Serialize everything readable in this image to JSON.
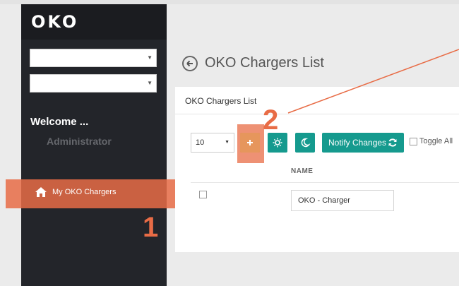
{
  "app": {
    "logo": "OKO"
  },
  "sidebar": {
    "select_1": "",
    "select_2": "",
    "welcome": "Welcome ...",
    "role": "Administrator",
    "menu": [
      {
        "label": "My OKO Chargers",
        "icon": "home-icon"
      }
    ]
  },
  "page": {
    "title": "OKO Chargers List"
  },
  "panel": {
    "title": "OKO Chargers List",
    "page_size": "10",
    "notify_label": "Notify Changes",
    "toggle_all_label": "Toggle All",
    "columns": [
      "NAME"
    ],
    "rows": [
      {
        "name": "OKO - Charger"
      }
    ]
  },
  "callouts": {
    "one": "1",
    "two": "2"
  },
  "colors": {
    "accent": "#e86c46",
    "teal": "#159a8e",
    "sidebar": "#23252a"
  }
}
